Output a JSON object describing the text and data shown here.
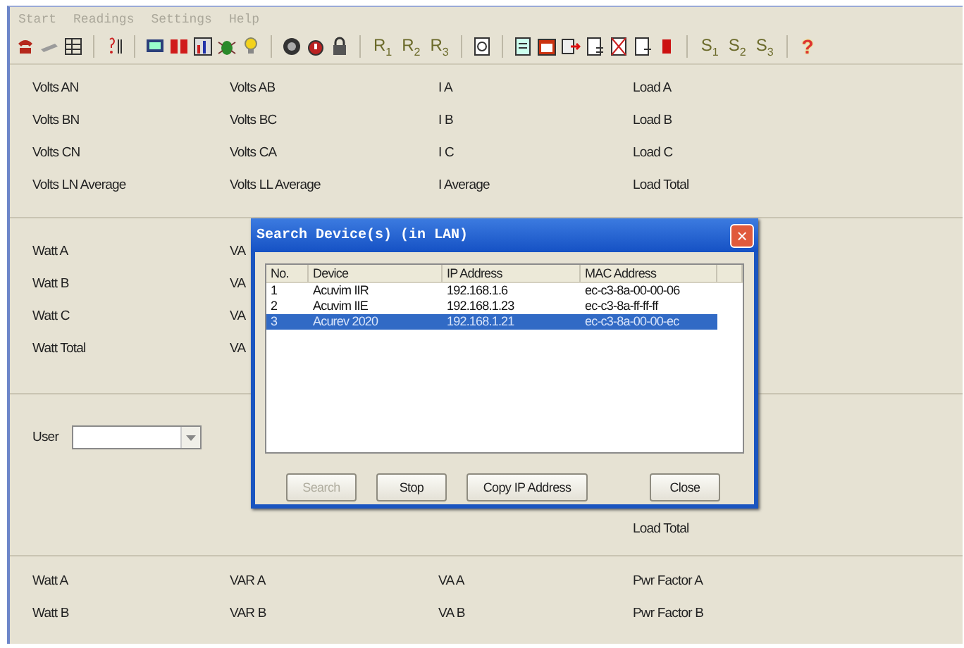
{
  "menu": [
    {
      "label": "Start",
      "disabled": true
    },
    {
      "label": "Readings",
      "disabled": true
    },
    {
      "label": "Settings",
      "disabled": true
    },
    {
      "label": "Help",
      "disabled": true
    }
  ],
  "toolbar": {
    "r_buttons": [
      "R$_{1}$",
      "R$_{2}$",
      "R$_{3}$"
    ],
    "s_buttons": [
      "S$_{1}$",
      "S$_{2}$",
      "S$_{3}$"
    ],
    "help": "?"
  },
  "voltage_section": {
    "rows": [
      [
        "Volts AN",
        "Volts AB",
        "I A",
        "Load A"
      ],
      [
        "Volts BN",
        "Volts BC",
        "I B",
        "Load B"
      ],
      [
        "Volts CN",
        "Volts CA",
        "I C",
        "Load C"
      ],
      [
        "Volts LN Average",
        "Volts LL Average",
        "I Average",
        "Load Total"
      ]
    ]
  },
  "power_section": {
    "rows": [
      [
        "Watt A",
        "VA"
      ],
      [
        "Watt B",
        "VA"
      ],
      [
        "Watt C",
        "VA"
      ],
      [
        "Watt Total",
        "VA"
      ]
    ]
  },
  "user_section": {
    "label": "User",
    "right_label": "Load Total"
  },
  "bottom_section": {
    "rows": [
      [
        "Watt A",
        "VAR A",
        "VA A",
        "Pwr Factor A"
      ],
      [
        "Watt B",
        "VAR B",
        "VA B",
        "Pwr Factor B"
      ]
    ]
  },
  "dialog": {
    "title": "Search Device(s) (in LAN)",
    "close": "×",
    "columns": [
      "No.",
      "Device",
      "IP Address",
      "MAC Address"
    ],
    "rows": [
      {
        "cells": [
          "1",
          "Acuvim IIR",
          "192.168.1.6",
          "ec-c3-8a-00-00-06"
        ],
        "selected": false
      },
      {
        "cells": [
          "2",
          "Acuvim IIE",
          "192.168.1.23",
          "ec-c3-8a-ff-ff-ff"
        ],
        "selected": false
      },
      {
        "cells": [
          "3",
          "Acurev 2020",
          "192.168.1.21",
          "ec-c3-8a-00-00-ec"
        ],
        "selected": true
      }
    ],
    "buttons": [
      {
        "label": "Search",
        "disabled": true
      },
      {
        "label": "Stop",
        "disabled": false
      },
      {
        "label": "Copy IP Address",
        "disabled": false
      },
      {
        "label": "Close",
        "disabled": false
      }
    ]
  }
}
